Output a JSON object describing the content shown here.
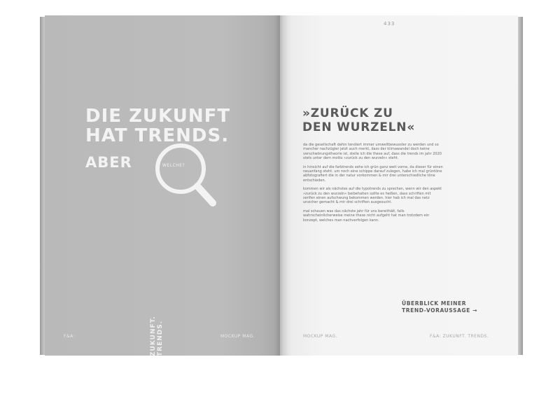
{
  "left_page": {
    "headline": "DIE ZUKUNFT\nHAT TRENDS.",
    "aber": "ABER",
    "lens_label": "WELCHE?",
    "vertical_title": "ZUKUNFT.\nTRENDS.",
    "footer_left": "F&A:",
    "footer_right": "MOCKUP MAG."
  },
  "right_page": {
    "page_number": "433",
    "title": "»ZURÜCK ZU\nDEN WURZELN«",
    "paragraphs": [
      "da die gesellschaft dahin tendiert immer umweltbewusster zu werden und so mancher nachzügler jetzt auch merkt, dass der klimawandel doch keine verschwörungstheorie ist, stelle ich die these auf, dass die trends im jahr 2020 stets unter dem motto »zurück zu den wurzeln« steht.",
      "in hinsicht auf die farbtrends sehe ich grün ganz weit vorne, da dieser für einen neuanfang steht. um noch eine schippe darauf zulegen, habe ich mal grüntöne abfotografiert die in der natur vorkommen & mir drei unterschiedliche töne entschieden.",
      "kommen wir als nächstes auf die typotrends zu sprechen, wenn wir den aspekt »zurück zu den wurzeln« beibehalten sollte es heißen, dass schriften mit serifen einen aufschwung bekommen werden. hier hab ich mal das netz unsicher gemacht & mir drei schriften ausgesucht.",
      "mal schauen was das nächste jahr für uns bereithält, falls wahrscheinlicherweise meine these nicht aufgeht hat man trotzdem ein konzept, welches man nachverfolgen kann."
    ],
    "cta": "ÜBERBLICK MEINER\nTREND-VORAUSSAGE →",
    "footer_left": "MOCKUP MAG.",
    "footer_right": "F&A: ZUKUNFT. TRENDS."
  },
  "colors": {
    "left_page_bg": "#bbbbbb",
    "right_page_bg": "#f4f4f4",
    "headline_text": "#f3f3f3",
    "body_text": "#6a6a6a"
  },
  "icons": {
    "lens": "magnifier-icon"
  }
}
